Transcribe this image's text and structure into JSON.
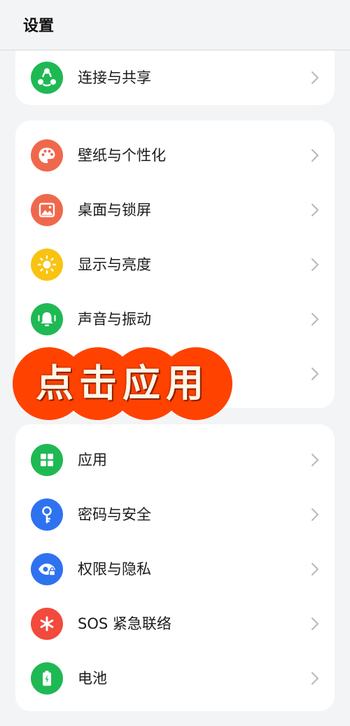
{
  "header": {
    "title": "设置"
  },
  "sections": [
    {
      "items": [
        {
          "label": "连接与共享",
          "icon": "share-nodes-icon",
          "color": "#1fb954"
        }
      ]
    },
    {
      "items": [
        {
          "label": "壁纸与个性化",
          "icon": "palette-icon",
          "color": "#f0684c"
        },
        {
          "label": "桌面与锁屏",
          "icon": "image-icon",
          "color": "#f0684c"
        },
        {
          "label": "显示与亮度",
          "icon": "sun-icon",
          "color": "#f9c312"
        },
        {
          "label": "声音与振动",
          "icon": "bell-icon",
          "color": "#1fb954"
        }
      ]
    },
    {
      "items": [
        {
          "label": "应用",
          "icon": "grid-icon",
          "color": "#1fb954"
        },
        {
          "label": "密码与安全",
          "icon": "key-icon",
          "color": "#2f72f0"
        },
        {
          "label": "权限与隐私",
          "icon": "eye-lock-icon",
          "color": "#2f72f0"
        },
        {
          "label": "SOS 紧急联络",
          "icon": "asterisk-icon",
          "color": "#f24a3c"
        },
        {
          "label": "电池",
          "icon": "battery-icon",
          "color": "#1fb954"
        }
      ]
    }
  ],
  "overlay": {
    "text": "点击应用",
    "color": "#ff4200"
  }
}
